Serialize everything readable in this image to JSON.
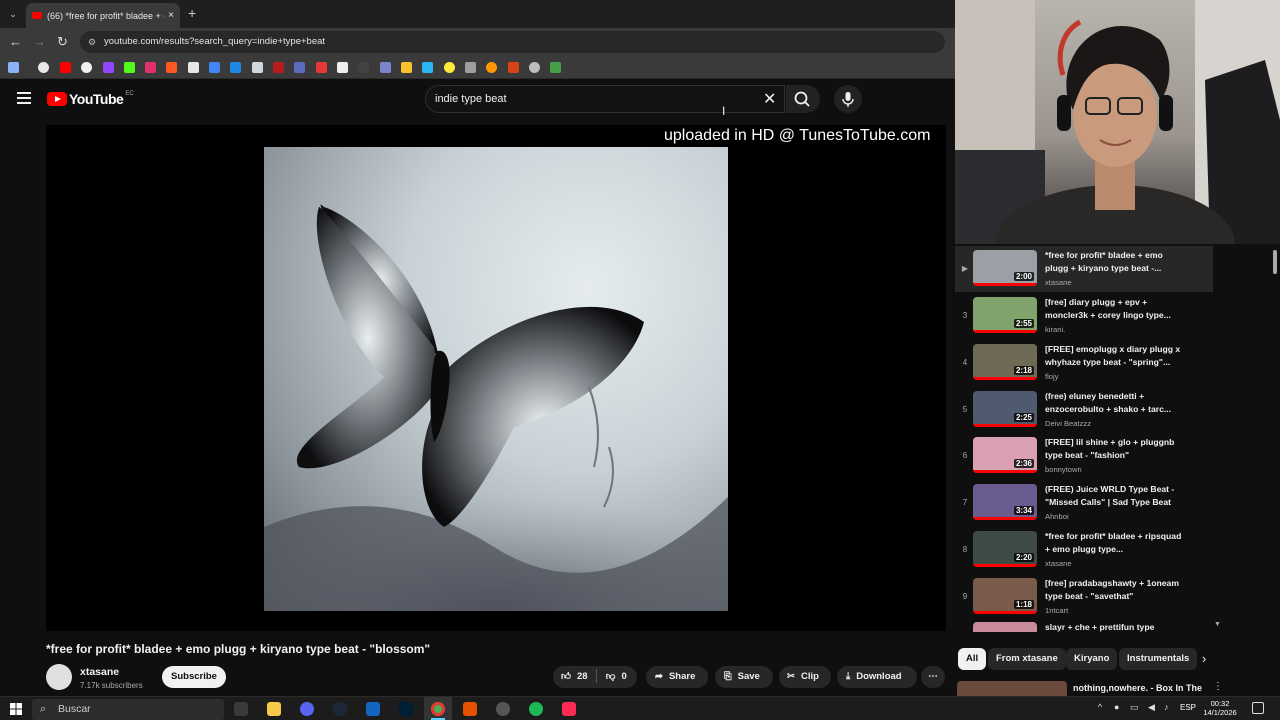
{
  "browser": {
    "tab_title": "(66) *free for profit* bladee + e",
    "url": "youtube.com/results?search_query=indie+type+beat",
    "tab_close": "×",
    "new_tab": "+"
  },
  "youtube": {
    "logo_text": "YouTube",
    "logo_country": "EC",
    "search_value": "indie type beat"
  },
  "video": {
    "watermark": "uploaded in HD @ TunesToTube.com",
    "title": "*free for profit* bladee + emo plugg + kiryano type beat - \"blossom\"",
    "channel": "xtasane",
    "subscribers": "7.17k subscribers",
    "subscribe_label": "Subscribe",
    "likes": "28",
    "dislikes": "0",
    "share_label": "Share",
    "save_label": "Save",
    "clip_label": "Clip",
    "download_label": "Download",
    "more_label": "⋯"
  },
  "playlist": [
    {
      "num": "▶",
      "title": "*free for profit* bladee + emo plugg + kiryano type beat -...",
      "channel": "xtasane",
      "duration": "2:00",
      "thumb": "#9aa0a6",
      "active": true
    },
    {
      "num": "3",
      "title": "[free] diary plugg + epv + moncler3k + corey lingo type...",
      "channel": "kirani.",
      "duration": "2:55",
      "thumb": "#7fa36a"
    },
    {
      "num": "4",
      "title": "[FREE] emoplugg x diary plugg x whyhaze type beat - \"spring\"...",
      "channel": "flojy",
      "duration": "2:18",
      "thumb": "#6f6a55"
    },
    {
      "num": "5",
      "title": "(free) eluney benedetti + enzocerobulto + shako + tarc...",
      "channel": "Deivi Beatzzz",
      "duration": "2:25",
      "thumb": "#4f5a6e"
    },
    {
      "num": "6",
      "title": "[FREE] lil shine + glo + pluggnb type beat - \"fashion\"",
      "channel": "bonnytown",
      "duration": "2:36",
      "thumb": "#d9a0b4"
    },
    {
      "num": "7",
      "title": "(FREE) Juice WRLD Type Beat - \"Missed Calls\" | Sad Type Beat",
      "channel": "Ahnboi",
      "duration": "3:34",
      "thumb": "#6a5c8e"
    },
    {
      "num": "8",
      "title": "*free for profit* bladee + ripsquad + emo plugg type...",
      "channel": "xtasane",
      "duration": "2:20",
      "thumb": "#3e4a45"
    },
    {
      "num": "9",
      "title": "[free] pradabagshawty + 1oneam type beat - \"savethat\"",
      "channel": "1ntcart",
      "duration": "1:18",
      "thumb": "#7a5a4a"
    },
    {
      "num": "",
      "title": "slayr + che + prettifun type",
      "channel": "",
      "duration": "",
      "thumb": "#c98a9a"
    }
  ],
  "chips": [
    "All",
    "From xtasane",
    "Kiryano",
    "Instrumentals"
  ],
  "next_rec_title": "nothing,nowhere. - Box In The",
  "taskbar": {
    "search_placeholder": "Buscar",
    "lang": "ESP",
    "time": "00:32",
    "date": "14/1/2026"
  }
}
